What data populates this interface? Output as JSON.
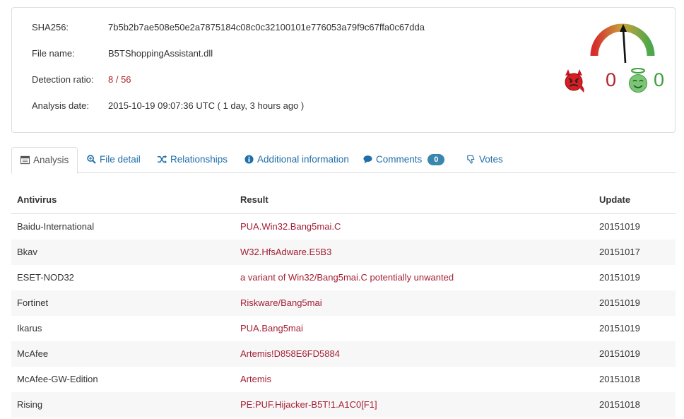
{
  "file_info": {
    "sha256_label": "SHA256:",
    "sha256_value": "7b5b2b7ae508e50e2a7875184c08c0c32100101e776053a79f9c67ffa0c67dda",
    "filename_label": "File name:",
    "filename_value": "B5TShoppingAssistant.dll",
    "ratio_label": "Detection ratio:",
    "ratio_value": "8 / 56",
    "date_label": "Analysis date:",
    "date_value": "2015-10-19 09:07:36 UTC ( 1 day, 3 hours ago )"
  },
  "community": {
    "bad_votes": "0",
    "good_votes": "0",
    "bad_color": "#b0252a",
    "good_color": "#3e9e3e"
  },
  "tabs": [
    {
      "label": "Analysis",
      "icon": "table-icon",
      "active": true
    },
    {
      "label": "File detail",
      "icon": "zoom-icon"
    },
    {
      "label": "Relationships",
      "icon": "shuffle-icon"
    },
    {
      "label": "Additional information",
      "icon": "info-icon"
    },
    {
      "label": "Comments",
      "icon": "comment-icon",
      "badge": "0"
    },
    {
      "label": "Votes",
      "icon": "thumbs-down-icon"
    }
  ],
  "table": {
    "headers": [
      "Antivirus",
      "Result",
      "Update"
    ],
    "rows": [
      [
        "Baidu-International",
        "PUA.Win32.Bang5mai.C",
        "20151019"
      ],
      [
        "Bkav",
        "W32.HfsAdware.E5B3",
        "20151017"
      ],
      [
        "ESET-NOD32",
        "a variant of Win32/Bang5mai.C potentially unwanted",
        "20151019"
      ],
      [
        "Fortinet",
        "Riskware/Bang5mai",
        "20151019"
      ],
      [
        "Ikarus",
        "PUA.Bang5mai",
        "20151019"
      ],
      [
        "McAfee",
        "Artemis!D858E6FD5884",
        "20151019"
      ],
      [
        "McAfee-GW-Edition",
        "Artemis",
        "20151018"
      ],
      [
        "Rising",
        "PE:PUF.Hijacker-B5T!1.A1C0[F1]",
        "20151018"
      ]
    ]
  }
}
